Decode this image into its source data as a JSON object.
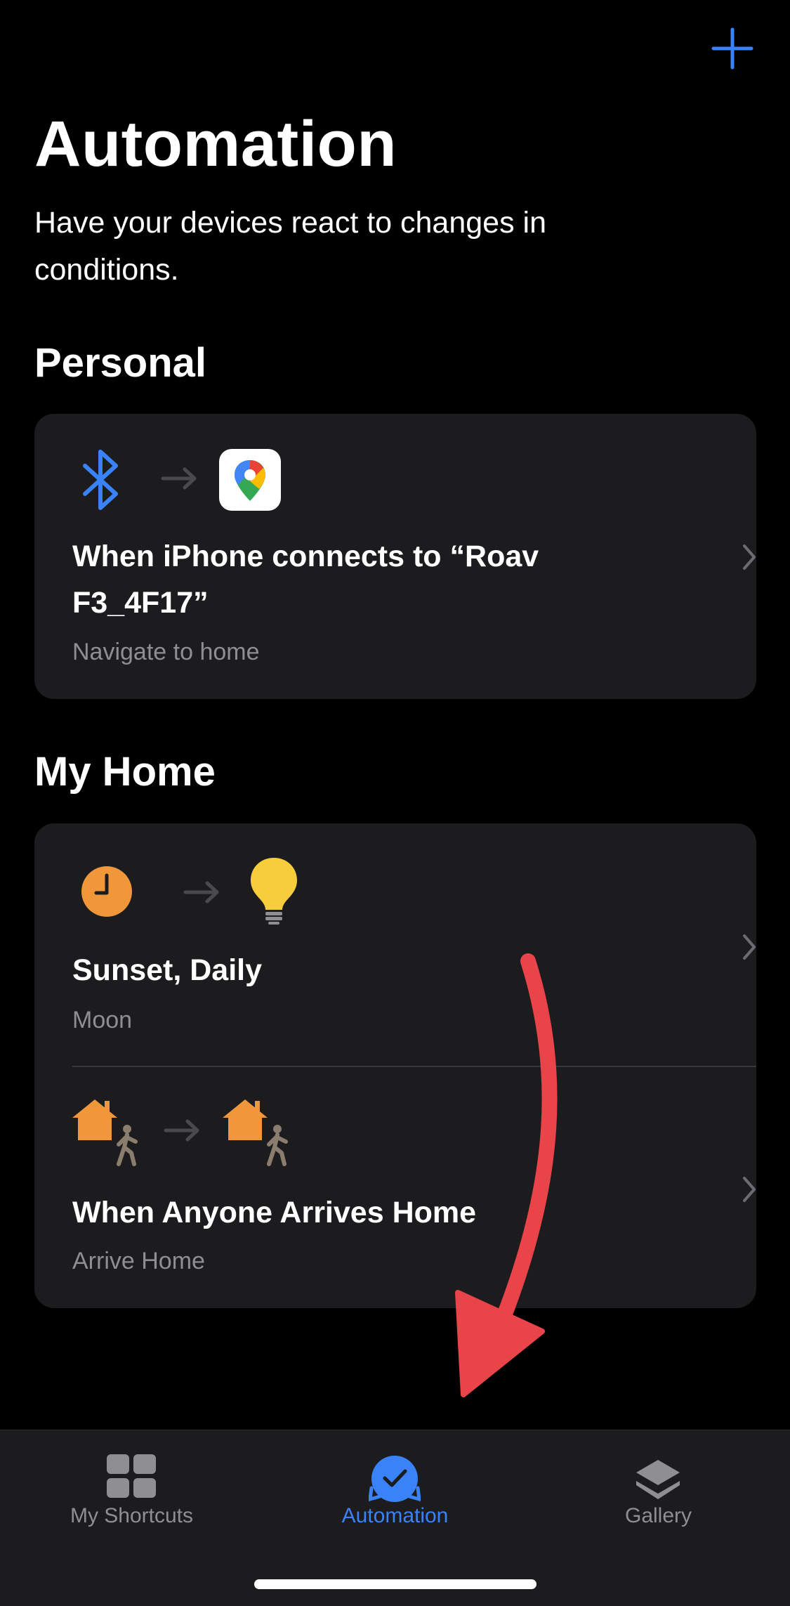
{
  "header": {
    "title": "Automation",
    "subtitle": "Have your devices react to changes in conditions."
  },
  "sections": {
    "personal": {
      "title": "Personal",
      "rows": [
        {
          "title": "When iPhone connects to “Roav F3_4F17”",
          "subtitle": "Navigate to home",
          "trigger_icon": "bluetooth-icon",
          "action_icon": "google-maps-icon"
        }
      ]
    },
    "my_home": {
      "title": "My Home",
      "rows": [
        {
          "title": "Sunset, Daily",
          "subtitle": "Moon",
          "trigger_icon": "clock-icon",
          "action_icon": "lightbulb-icon"
        },
        {
          "title": "When Anyone Arrives Home",
          "subtitle": "Arrive Home",
          "trigger_icon": "home-person-icon",
          "action_icon": "home-person-icon"
        }
      ]
    }
  },
  "tabbar": {
    "tabs": [
      {
        "label": "My Shortcuts",
        "icon": "grid-icon",
        "active": false
      },
      {
        "label": "Automation",
        "icon": "checkmark-clock-icon",
        "active": true
      },
      {
        "label": "Gallery",
        "icon": "layers-icon",
        "active": false
      }
    ]
  },
  "colors": {
    "accent": "#3a82f7",
    "card": "#1c1c1e",
    "secondary_text": "#8e8e93",
    "annotation_arrow": "#e8444a",
    "home_orange": "#f0973a",
    "bulb_yellow": "#f8cd3c"
  }
}
